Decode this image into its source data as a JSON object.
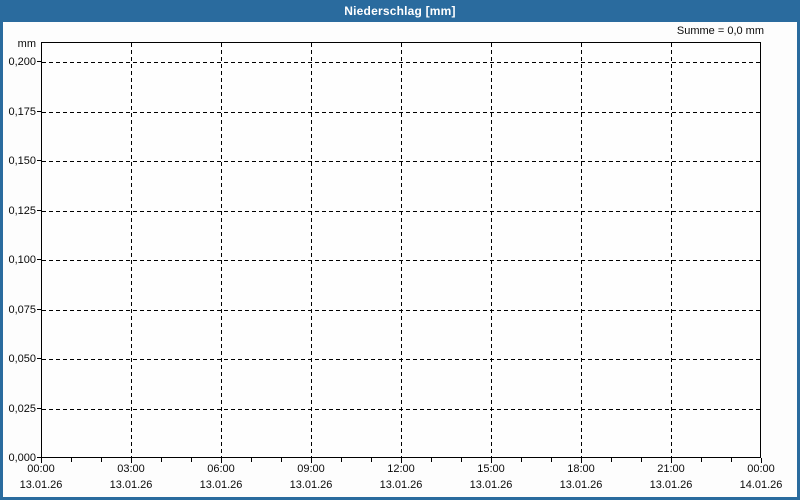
{
  "title_bar": {
    "title": "Niederschlag [mm]"
  },
  "summary": {
    "text": "Summe = 0,0 mm"
  },
  "colors": {
    "frame_blue": "#2a6b9e",
    "title_text": "#ffffff",
    "axis_black": "#000000",
    "background": "#fdfdfd",
    "plot_background": "#fefefe"
  },
  "chart_data": {
    "type": "line",
    "title": "Niederschlag [mm]",
    "ylabel_unit": "mm",
    "annotation": "Summe = 0,0 mm",
    "ylim": [
      0,
      0.21
    ],
    "xlim_hours": [
      0,
      24
    ],
    "grid": "dashed",
    "legend": "none",
    "y_ticks": [
      {
        "label": "0,200",
        "value": 0.2
      },
      {
        "label": "0,175",
        "value": 0.175
      },
      {
        "label": "0,150",
        "value": 0.15
      },
      {
        "label": "0,125",
        "value": 0.125
      },
      {
        "label": "0,100",
        "value": 0.1
      },
      {
        "label": "0,075",
        "value": 0.075
      },
      {
        "label": "0,050",
        "value": 0.05
      },
      {
        "label": "0,025",
        "value": 0.025
      },
      {
        "label": "0,000",
        "value": 0.0
      }
    ],
    "x_ticks": [
      {
        "hour": 0,
        "time": "00:00",
        "date": "13.01.26"
      },
      {
        "hour": 3,
        "time": "03:00",
        "date": "13.01.26"
      },
      {
        "hour": 6,
        "time": "06:00",
        "date": "13.01.26"
      },
      {
        "hour": 9,
        "time": "09:00",
        "date": "13.01.26"
      },
      {
        "hour": 12,
        "time": "12:00",
        "date": "13.01.26"
      },
      {
        "hour": 15,
        "time": "15:00",
        "date": "13.01.26"
      },
      {
        "hour": 18,
        "time": "18:00",
        "date": "13.01.26"
      },
      {
        "hour": 21,
        "time": "21:00",
        "date": "13.01.26"
      },
      {
        "hour": 24,
        "time": "00:00",
        "date": "14.01.26"
      }
    ],
    "minor_tick_interval_hours": 1,
    "series": [
      {
        "name": "Niederschlag",
        "values": [],
        "sum_mm": 0.0
      }
    ]
  }
}
